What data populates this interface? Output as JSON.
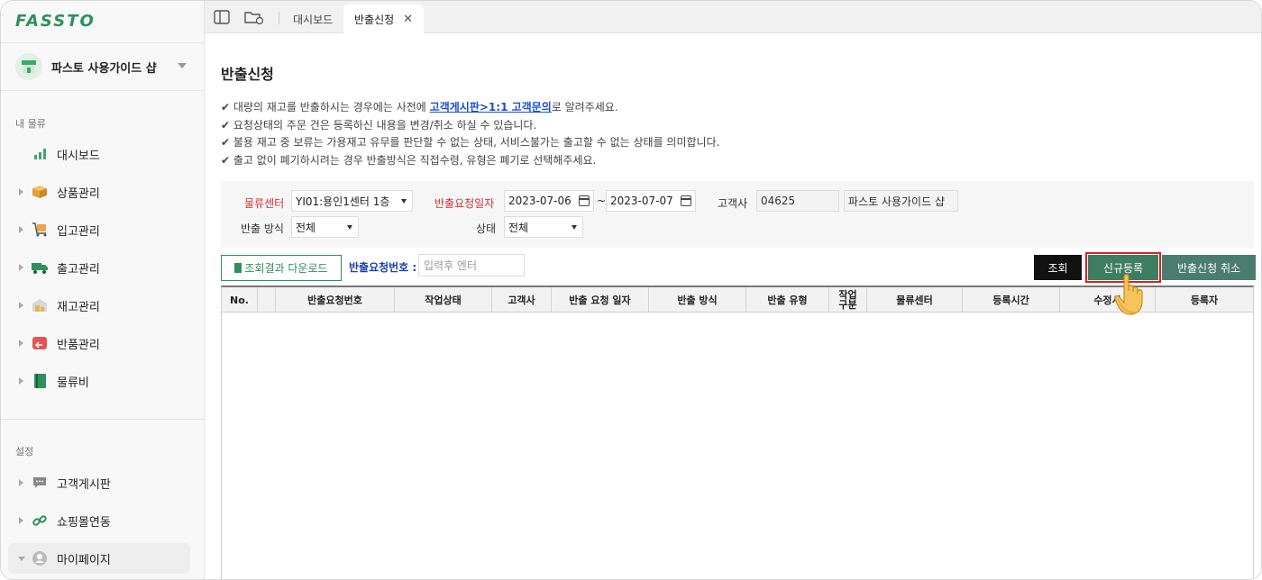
{
  "brand": {
    "logo_text": "FASSTO",
    "accent": "#2f8f5e"
  },
  "shop": {
    "name": "파스토 사용가이드 샵",
    "icon": "store-icon"
  },
  "sidebar": {
    "section_my": "내 물류",
    "items": [
      {
        "label": "대시보드",
        "icon": "chart-icon"
      },
      {
        "label": "상품관리",
        "icon": "box-icon"
      },
      {
        "label": "입고관리",
        "icon": "cart-icon"
      },
      {
        "label": "출고관리",
        "icon": "truck-icon"
      },
      {
        "label": "재고관리",
        "icon": "warehouse-icon"
      },
      {
        "label": "반품관리",
        "icon": "return-icon"
      },
      {
        "label": "물류비",
        "icon": "ledger-icon"
      }
    ],
    "section_settings": "설정",
    "settings_items": [
      {
        "label": "고객게시판",
        "icon": "chat-icon"
      },
      {
        "label": "쇼핑몰연동",
        "icon": "link-icon"
      },
      {
        "label": "마이페이지",
        "icon": "user-icon"
      }
    ]
  },
  "tabs": [
    {
      "label": "대시보드"
    },
    {
      "label": "반출신청",
      "active": true
    }
  ],
  "page": {
    "title": "반출신청",
    "notes": {
      "line1_pre": "✔ 대량의 재고를 반출하시는 경우에는 사전에 ",
      "line1_link": "고객게시판>1:1 고객문의",
      "line1_post": "로 알려주세요.",
      "line2": "✔ 요청상태의 주문 건은 등록하신 내용을 변경/취소 하실 수 있습니다.",
      "line3": "✔ 불용 재고 중 보류는 가용재고 유무를 판단할 수 없는 상태, 서비스불가는 출고할 수 없는 상태를 의미합니다.",
      "line4": "✔ 출고 없이 폐기하시려는 경우 반출방식은 직접수령, 유형은 폐기로 선택해주세요."
    }
  },
  "filter": {
    "center_label": "물류센터",
    "center_value": "YI01:용인1센터 1층",
    "date_label": "반출요청일자",
    "date_from": "2023-07-06",
    "date_sep": "~",
    "date_to": "2023-07-07",
    "customer_label": "고객사",
    "customer_code": "04625",
    "customer_name": "파스토 사용가이드 샵",
    "method_label": "반출 방식",
    "method_value": "전체",
    "status_label": "상태",
    "status_value": "전체"
  },
  "toolbar": {
    "download_label": "조회결과 다운로드",
    "request_no_label": "반출요청번호 :",
    "request_no_placeholder": "입력후 엔터",
    "search_label": "조회",
    "new_label": "신규등록",
    "cancel_label": "반출신청 취소"
  },
  "table": {
    "columns": [
      "No.",
      "",
      "반출요청번호",
      "작업상태",
      "고객사",
      "반출 요청 일자",
      "반출 방식",
      "반출 유형",
      "작업\n구분",
      "물류센터",
      "등록시간",
      "수정시",
      "등록자"
    ]
  }
}
